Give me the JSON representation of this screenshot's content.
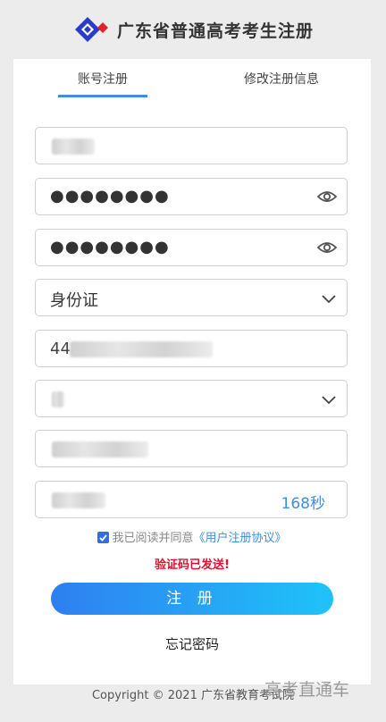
{
  "header": {
    "title": "广东省普通高考考生注册",
    "logo_icon": "exam-authority-logo"
  },
  "tabs": [
    {
      "label": "账号注册",
      "active": true
    },
    {
      "label": "修改注册信息",
      "active": false
    }
  ],
  "form": {
    "password_value": "●●●●●●●●",
    "confirm_password_value": "●●●●●●●●",
    "id_type_value": "身份证",
    "id_number_prefix": "44",
    "countdown_text": "168秒"
  },
  "agreement": {
    "text": "我已阅读并同意",
    "link": "《用户注册协议》",
    "checked": true
  },
  "notice": "验证码已发送!",
  "register_button": "注  册",
  "forgot_link": "忘记密码",
  "footer": "Copyright © 2021 广东省教育考试院",
  "watermark": "高考直通车",
  "colors": {
    "accent": "#3d8ee8",
    "alert": "#e0102e",
    "button_start": "#2f7ff0",
    "button_end": "#1fc3f8"
  }
}
